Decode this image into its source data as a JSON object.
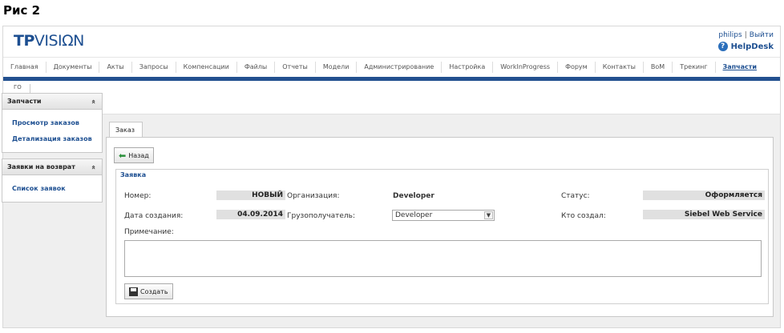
{
  "caption": "Рис 2",
  "brand": {
    "part1": "TP",
    "part2": "VISIΩN"
  },
  "user": {
    "name": "philips",
    "separator": "|",
    "logout": "Выйти",
    "help_glyph": "?",
    "helpdesk": "HelpDesk"
  },
  "nav": [
    "Главная",
    "Документы",
    "Акты",
    "Запросы",
    "Компенсации",
    "Файлы",
    "Отчеты",
    "Модели",
    "Администрирование",
    "Настройка",
    "WorkInProgress",
    "Форум",
    "Контакты",
    "BoM",
    "Трекинг",
    "Запчасти"
  ],
  "nav_active": "Запчасти",
  "subnav": {
    "go": "ГО"
  },
  "sidebar": {
    "block1": {
      "title": "Запчасти",
      "chev": "«",
      "links": [
        "Просмотр заказов",
        "Детализация заказов"
      ]
    },
    "block2": {
      "title": "Заявки на возврат",
      "chev": "«",
      "links": [
        "Список заявок"
      ]
    }
  },
  "tab": "Заказ",
  "back_button": "Назад",
  "form": {
    "legend": "Заявка",
    "number_label": "Номер:",
    "number_value": "НОВЫЙ",
    "org_label": "Организация:",
    "org_value": "Developer",
    "status_label": "Статус:",
    "status_value": "Оформляется",
    "date_label": "Дата создания:",
    "date_value": "04.09.2014",
    "consignee_label": "Грузополучатель:",
    "consignee_value": "Developer",
    "creator_label": "Кто создал:",
    "creator_value": "Siebel Web Service",
    "note_label": "Примечание:",
    "note_value": "",
    "create_button": "Создать"
  },
  "colors": {
    "brand": "#1d4f91",
    "band": "#22508f",
    "back_arrow": "#2a8f3a"
  },
  "icons": {
    "back": "arrow-left-icon",
    "save": "floppy-disk-icon",
    "help": "help-circle-icon",
    "chev": "chevron-up-double-icon",
    "dropdown": "chevron-down-icon"
  }
}
